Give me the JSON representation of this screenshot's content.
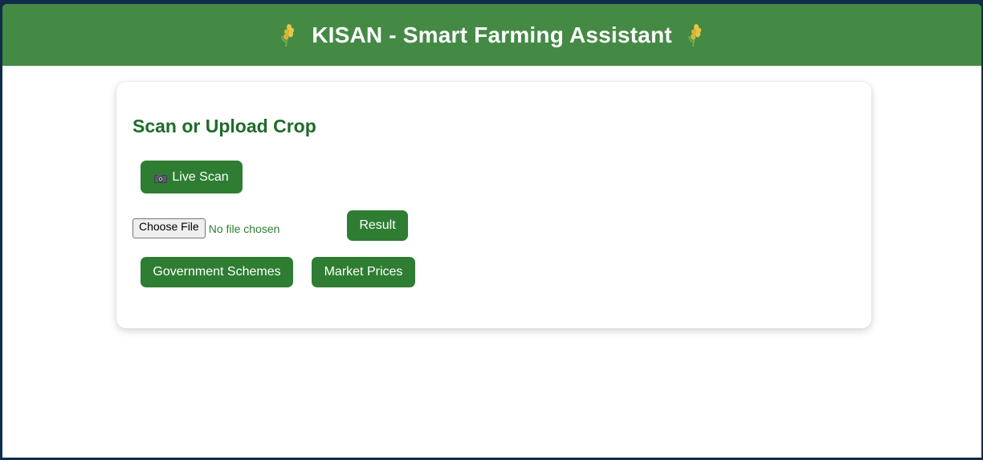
{
  "header": {
    "title": "KISAN - Smart Farming Assistant",
    "icon": "wheat-icon",
    "background": "#448a45"
  },
  "card": {
    "title": "Scan or Upload Crop",
    "live_scan_label": "Live Scan",
    "live_scan_icon": "camera-icon",
    "file_input": {
      "button_label": "Choose File",
      "status": "No file chosen"
    },
    "result_label": "Result",
    "schemes_label": "Government Schemes",
    "market_label": "Market Prices"
  },
  "colors": {
    "accent": "#2e7d32",
    "title": "#1f6b2a"
  }
}
